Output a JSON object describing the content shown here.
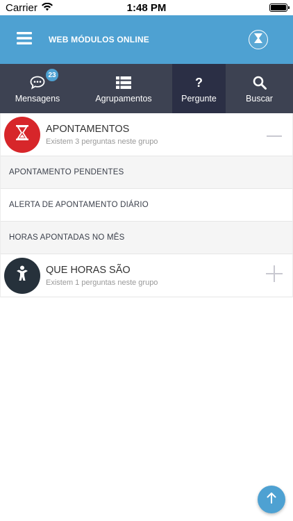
{
  "status_bar": {
    "carrier": "Carrier",
    "time": "1:48 PM"
  },
  "header": {
    "title": "WEB MÓDULOS ONLINE",
    "menu_icon": "hamburger-icon",
    "logo_icon": "hourglass-icon"
  },
  "tabs": [
    {
      "label": "Mensagens",
      "icon": "chat-icon",
      "badge": "23",
      "active": false
    },
    {
      "label": "Agrupamentos",
      "icon": "list-icon",
      "active": false
    },
    {
      "label": "Pergunte",
      "icon": "question-icon",
      "glyph": "?",
      "active": true
    },
    {
      "label": "Buscar",
      "icon": "search-icon",
      "active": false
    }
  ],
  "groups": [
    {
      "title": "APONTAMENTOS",
      "subtitle": "Existem 3 perguntas neste grupo",
      "icon": "hourglass-icon",
      "color": "#d7262a",
      "expanded": true,
      "items": [
        "APONTAMENTO PENDENTES",
        "ALERTA DE APONTAMENTO DIÁRIO",
        "HORAS APONTADAS NO MÊS"
      ]
    },
    {
      "title": "QUE HORAS SÃO",
      "subtitle": "Existem 1 perguntas neste grupo",
      "icon": "person-icon",
      "color": "#26313b",
      "expanded": false
    }
  ],
  "colors": {
    "header": "#4ea1d2",
    "tab_bar": "#3d4252",
    "tab_active": "#2b2f45",
    "accent": "#4ea1d2"
  },
  "fab": {
    "icon": "arrow-up-icon"
  }
}
